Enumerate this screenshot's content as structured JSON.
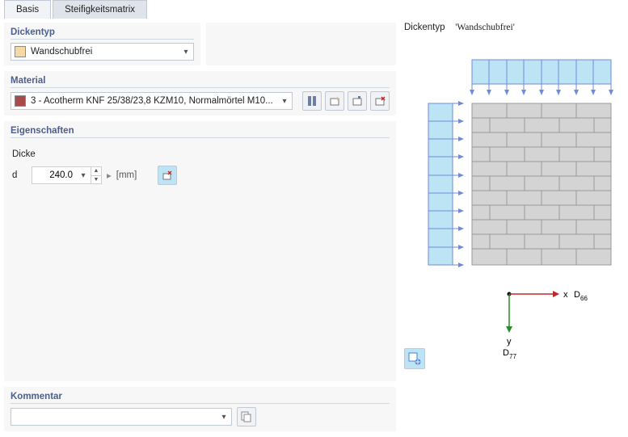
{
  "tabs": [
    "Basis",
    "Steifigkeitsmatrix"
  ],
  "active_tab": 1,
  "dickentyp": {
    "header": "Dickentyp",
    "value": "Wandschubfrei",
    "swatch": "#f6d9a2"
  },
  "material": {
    "header": "Material",
    "value": "3 - Acotherm KNF 25/38/23,8 KZM10, Normalmörtel M10...",
    "swatch": "#a94a4a"
  },
  "eigenschaften": {
    "header": "Eigenschaften",
    "dicke_label": "Dicke",
    "sym": "d",
    "value": "240.0",
    "unit": "[mm]"
  },
  "kommentar": {
    "header": "Kommentar",
    "value": ""
  },
  "preview": {
    "label_prefix": "Dickentyp",
    "label_value": "'Wandschubfrei'",
    "axis_x": "x",
    "axis_y": "y",
    "d66": "D",
    "d66_sub": "66",
    "d77": "D",
    "d77_sub": "77"
  }
}
